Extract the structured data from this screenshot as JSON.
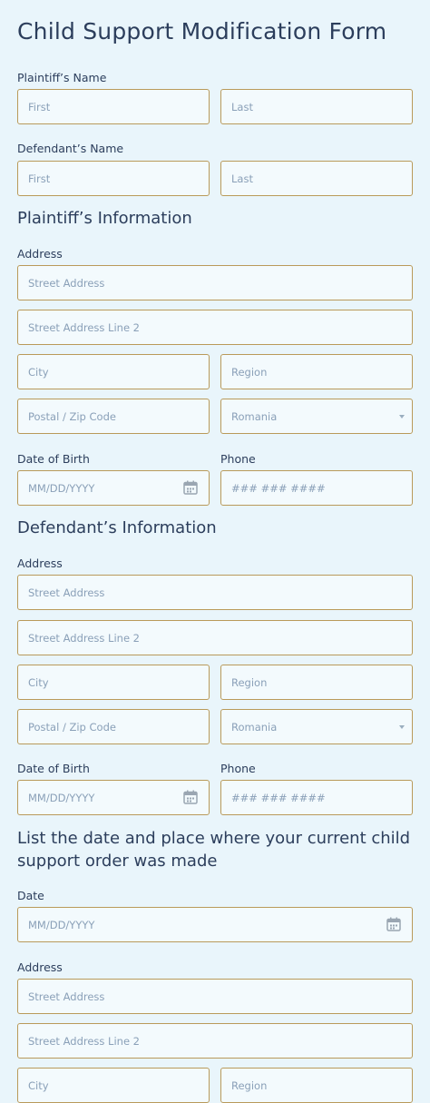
{
  "form": {
    "title": "Child Support Modification Form",
    "plaintiff_name": {
      "label": "Plaintiff’s Name",
      "first_placeholder": "First",
      "last_placeholder": "Last"
    },
    "defendant_name": {
      "label": "Defendant’s Name",
      "first_placeholder": "First",
      "last_placeholder": "Last"
    },
    "plaintiff_info": {
      "heading": "Plaintiff’s Information",
      "address_label": "Address",
      "street_placeholder": "Street Address",
      "street2_placeholder": "Street Address Line 2",
      "city_placeholder": "City",
      "region_placeholder": "Region",
      "postal_placeholder": "Postal / Zip Code",
      "country_value": "Romania",
      "dob_label": "Date of Birth",
      "dob_placeholder": "MM/DD/YYYY",
      "phone_label": "Phone",
      "phone_placeholder": "### ### ####"
    },
    "defendant_info": {
      "heading": "Defendant’s Information",
      "address_label": "Address",
      "street_placeholder": "Street Address",
      "street2_placeholder": "Street Address Line 2",
      "city_placeholder": "City",
      "region_placeholder": "Region",
      "postal_placeholder": "Postal / Zip Code",
      "country_value": "Romania",
      "dob_label": "Date of Birth",
      "dob_placeholder": "MM/DD/YYYY",
      "phone_label": "Phone",
      "phone_placeholder": "### ### ####"
    },
    "order_info": {
      "heading": "List the date and place where your current child support order was made",
      "date_label": "Date",
      "date_placeholder": "MM/DD/YYYY",
      "address_label": "Address",
      "street_placeholder": "Street Address",
      "street2_placeholder": "Street Address Line 2",
      "city_placeholder": "City",
      "region_placeholder": "Region"
    }
  },
  "colors": {
    "background": "#e9f5fb",
    "field_bg": "#f3fafd",
    "field_border": "#b99a5a",
    "text": "#2c3e5c",
    "placeholder": "#8aa0b8"
  },
  "icons": {
    "calendar": "calendar-icon",
    "dropdown": "chevron-down-icon"
  }
}
